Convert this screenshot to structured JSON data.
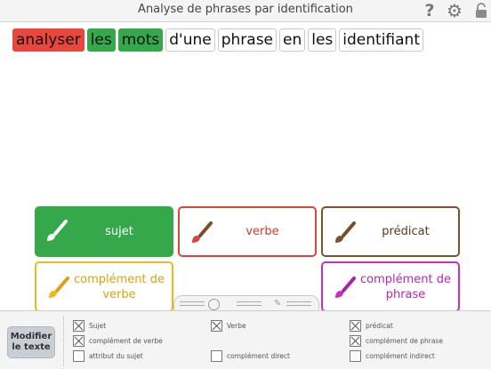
{
  "title": "Analyse de phrases par identification",
  "toolbar": {
    "help_label": "?",
    "settings_icon": "gear-icon",
    "lock_icon": "padlock-icon"
  },
  "sentence": {
    "words": [
      {
        "text": "analyser",
        "highlight": "#e8463e"
      },
      {
        "text": "les",
        "highlight": "#36a84c"
      },
      {
        "text": "mots",
        "highlight": "#36a84c"
      },
      {
        "text": "d'une",
        "highlight": ""
      },
      {
        "text": "phrase",
        "highlight": ""
      },
      {
        "text": "en",
        "highlight": ""
      },
      {
        "text": "les",
        "highlight": ""
      },
      {
        "text": "identifiant",
        "highlight": ""
      }
    ]
  },
  "categories": {
    "sujet": "sujet",
    "verbe": "verbe",
    "predicat": "prédicat",
    "complement_verbe": "complément de verbe",
    "complement_phrase": "complément de phrase"
  },
  "colors": {
    "sujet": "#36a84c",
    "verbe": "#e0433c",
    "predicat": "#7b5230",
    "complement_verbe": "#f2b71c",
    "complement_phrase": "#c62ec6"
  },
  "panel": {
    "modifier_button": "Modifier le texte",
    "options": {
      "sujet": {
        "label": "Sujet",
        "checked": true
      },
      "verbe": {
        "label": "Verbe",
        "checked": true
      },
      "predicat": {
        "label": "prédicat",
        "checked": true
      },
      "complement_verbe": {
        "label": "complément de verbe",
        "checked": true
      },
      "complement_phrase": {
        "label": "complément de phrase",
        "checked": true
      },
      "attribut_sujet": {
        "label": "attribut du sujet",
        "checked": false
      },
      "complement_direct": {
        "label": "complément direct",
        "checked": false
      },
      "complement_indirect": {
        "label": "complément indirect",
        "checked": false
      }
    }
  }
}
